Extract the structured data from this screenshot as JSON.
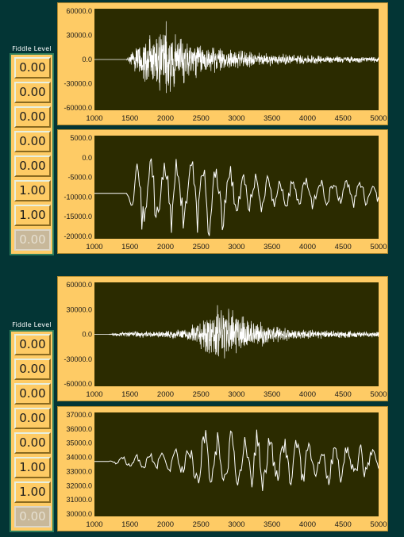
{
  "fiddle_groups": [
    {
      "title": "Fiddle Level",
      "values": [
        "0.00",
        "0.00",
        "0.00",
        "0.00",
        "0.00",
        "1.00",
        "1.00",
        "0.00"
      ]
    },
    {
      "title": "Fiddle Level",
      "values": [
        "0.00",
        "0.00",
        "0.00",
        "0.00",
        "0.00",
        "1.00",
        "1.00",
        "0.00"
      ]
    }
  ],
  "colors": {
    "background": "#033535",
    "panel": "#fecb65",
    "plot": "#2b2b00",
    "trace": "#ffffff"
  },
  "chart_data": [
    {
      "type": "line",
      "ytype": "noise",
      "x_ticks": [
        "1000",
        "1500",
        "2000",
        "2500",
        "3000",
        "3500",
        "4000",
        "4500",
        "5000"
      ],
      "y_ticks": [
        "60000.0",
        "30000.0",
        "0.0",
        "-30000.0",
        "-60000.0"
      ],
      "xlim": [
        1000,
        5000
      ],
      "ylim": [
        -60000,
        60000
      ],
      "x_points": [
        1000,
        1450,
        1500,
        1700,
        1900,
        2000,
        2100,
        2300,
        2600,
        3000,
        3500,
        4000,
        4500,
        5000
      ],
      "envelope": [
        0,
        0,
        8000,
        30000,
        45000,
        50000,
        42000,
        30000,
        18000,
        12000,
        8000,
        6000,
        4500,
        3500
      ],
      "baseline": 0
    },
    {
      "type": "line",
      "ytype": "smooth",
      "x_ticks": [
        "1000",
        "1500",
        "2000",
        "2500",
        "3000",
        "3500",
        "4000",
        "4500",
        "5000"
      ],
      "y_ticks": [
        "5000.0",
        "0.0",
        "-5000.0",
        "-10000.0",
        "-15000.0",
        "-20000.0"
      ],
      "xlim": [
        1000,
        5000
      ],
      "ylim": [
        -20000,
        5000
      ],
      "x_points": [
        1000,
        1150,
        1300,
        1450,
        1600,
        1800,
        2000,
        2200,
        2500,
        2700,
        3000,
        3300,
        3600,
        3900,
        4200,
        4500,
        4700,
        5000
      ],
      "envelope": [
        0,
        0,
        0,
        0,
        9000,
        11000,
        10000,
        9500,
        10000,
        11000,
        7000,
        5000,
        4500,
        4000,
        4000,
        4000,
        3500,
        3500
      ],
      "baseline": -9000
    },
    {
      "type": "line",
      "ytype": "noise",
      "x_ticks": [
        "1000",
        "1500",
        "2000",
        "2500",
        "3000",
        "3500",
        "4000",
        "4500",
        "5000"
      ],
      "y_ticks": [
        "60000.0",
        "30000.0",
        "0.0",
        "-30000.0",
        "-60000.0"
      ],
      "xlim": [
        1000,
        5000
      ],
      "ylim": [
        -60000,
        60000
      ],
      "x_points": [
        1000,
        1200,
        1300,
        1500,
        2000,
        2300,
        2500,
        2700,
        2900,
        3000,
        3200,
        3500,
        4000,
        4500,
        5000
      ],
      "envelope": [
        0,
        0,
        2500,
        4000,
        5000,
        7000,
        20000,
        35000,
        40000,
        32000,
        20000,
        10000,
        6000,
        4500,
        3500
      ],
      "baseline": 0
    },
    {
      "type": "line",
      "ytype": "smooth",
      "x_ticks": [
        "1000",
        "1500",
        "2000",
        "2500",
        "3000",
        "3500",
        "4000",
        "4500",
        "5000"
      ],
      "y_ticks": [
        "37000.0",
        "36000.0",
        "35000.0",
        "34000.0",
        "33000.0",
        "32000.0",
        "31000.0",
        "30000.0"
      ],
      "xlim": [
        1000,
        5000
      ],
      "ylim": [
        30000,
        37000
      ],
      "x_points": [
        1000,
        1200,
        1300,
        1600,
        2000,
        2300,
        2500,
        2700,
        3000,
        3300,
        3600,
        4000,
        4300,
        4600,
        5000
      ],
      "envelope": [
        0,
        0,
        300,
        500,
        800,
        1000,
        3000,
        2500,
        2200,
        2500,
        1600,
        1600,
        1600,
        1500,
        1200
      ],
      "baseline": 33700
    }
  ]
}
